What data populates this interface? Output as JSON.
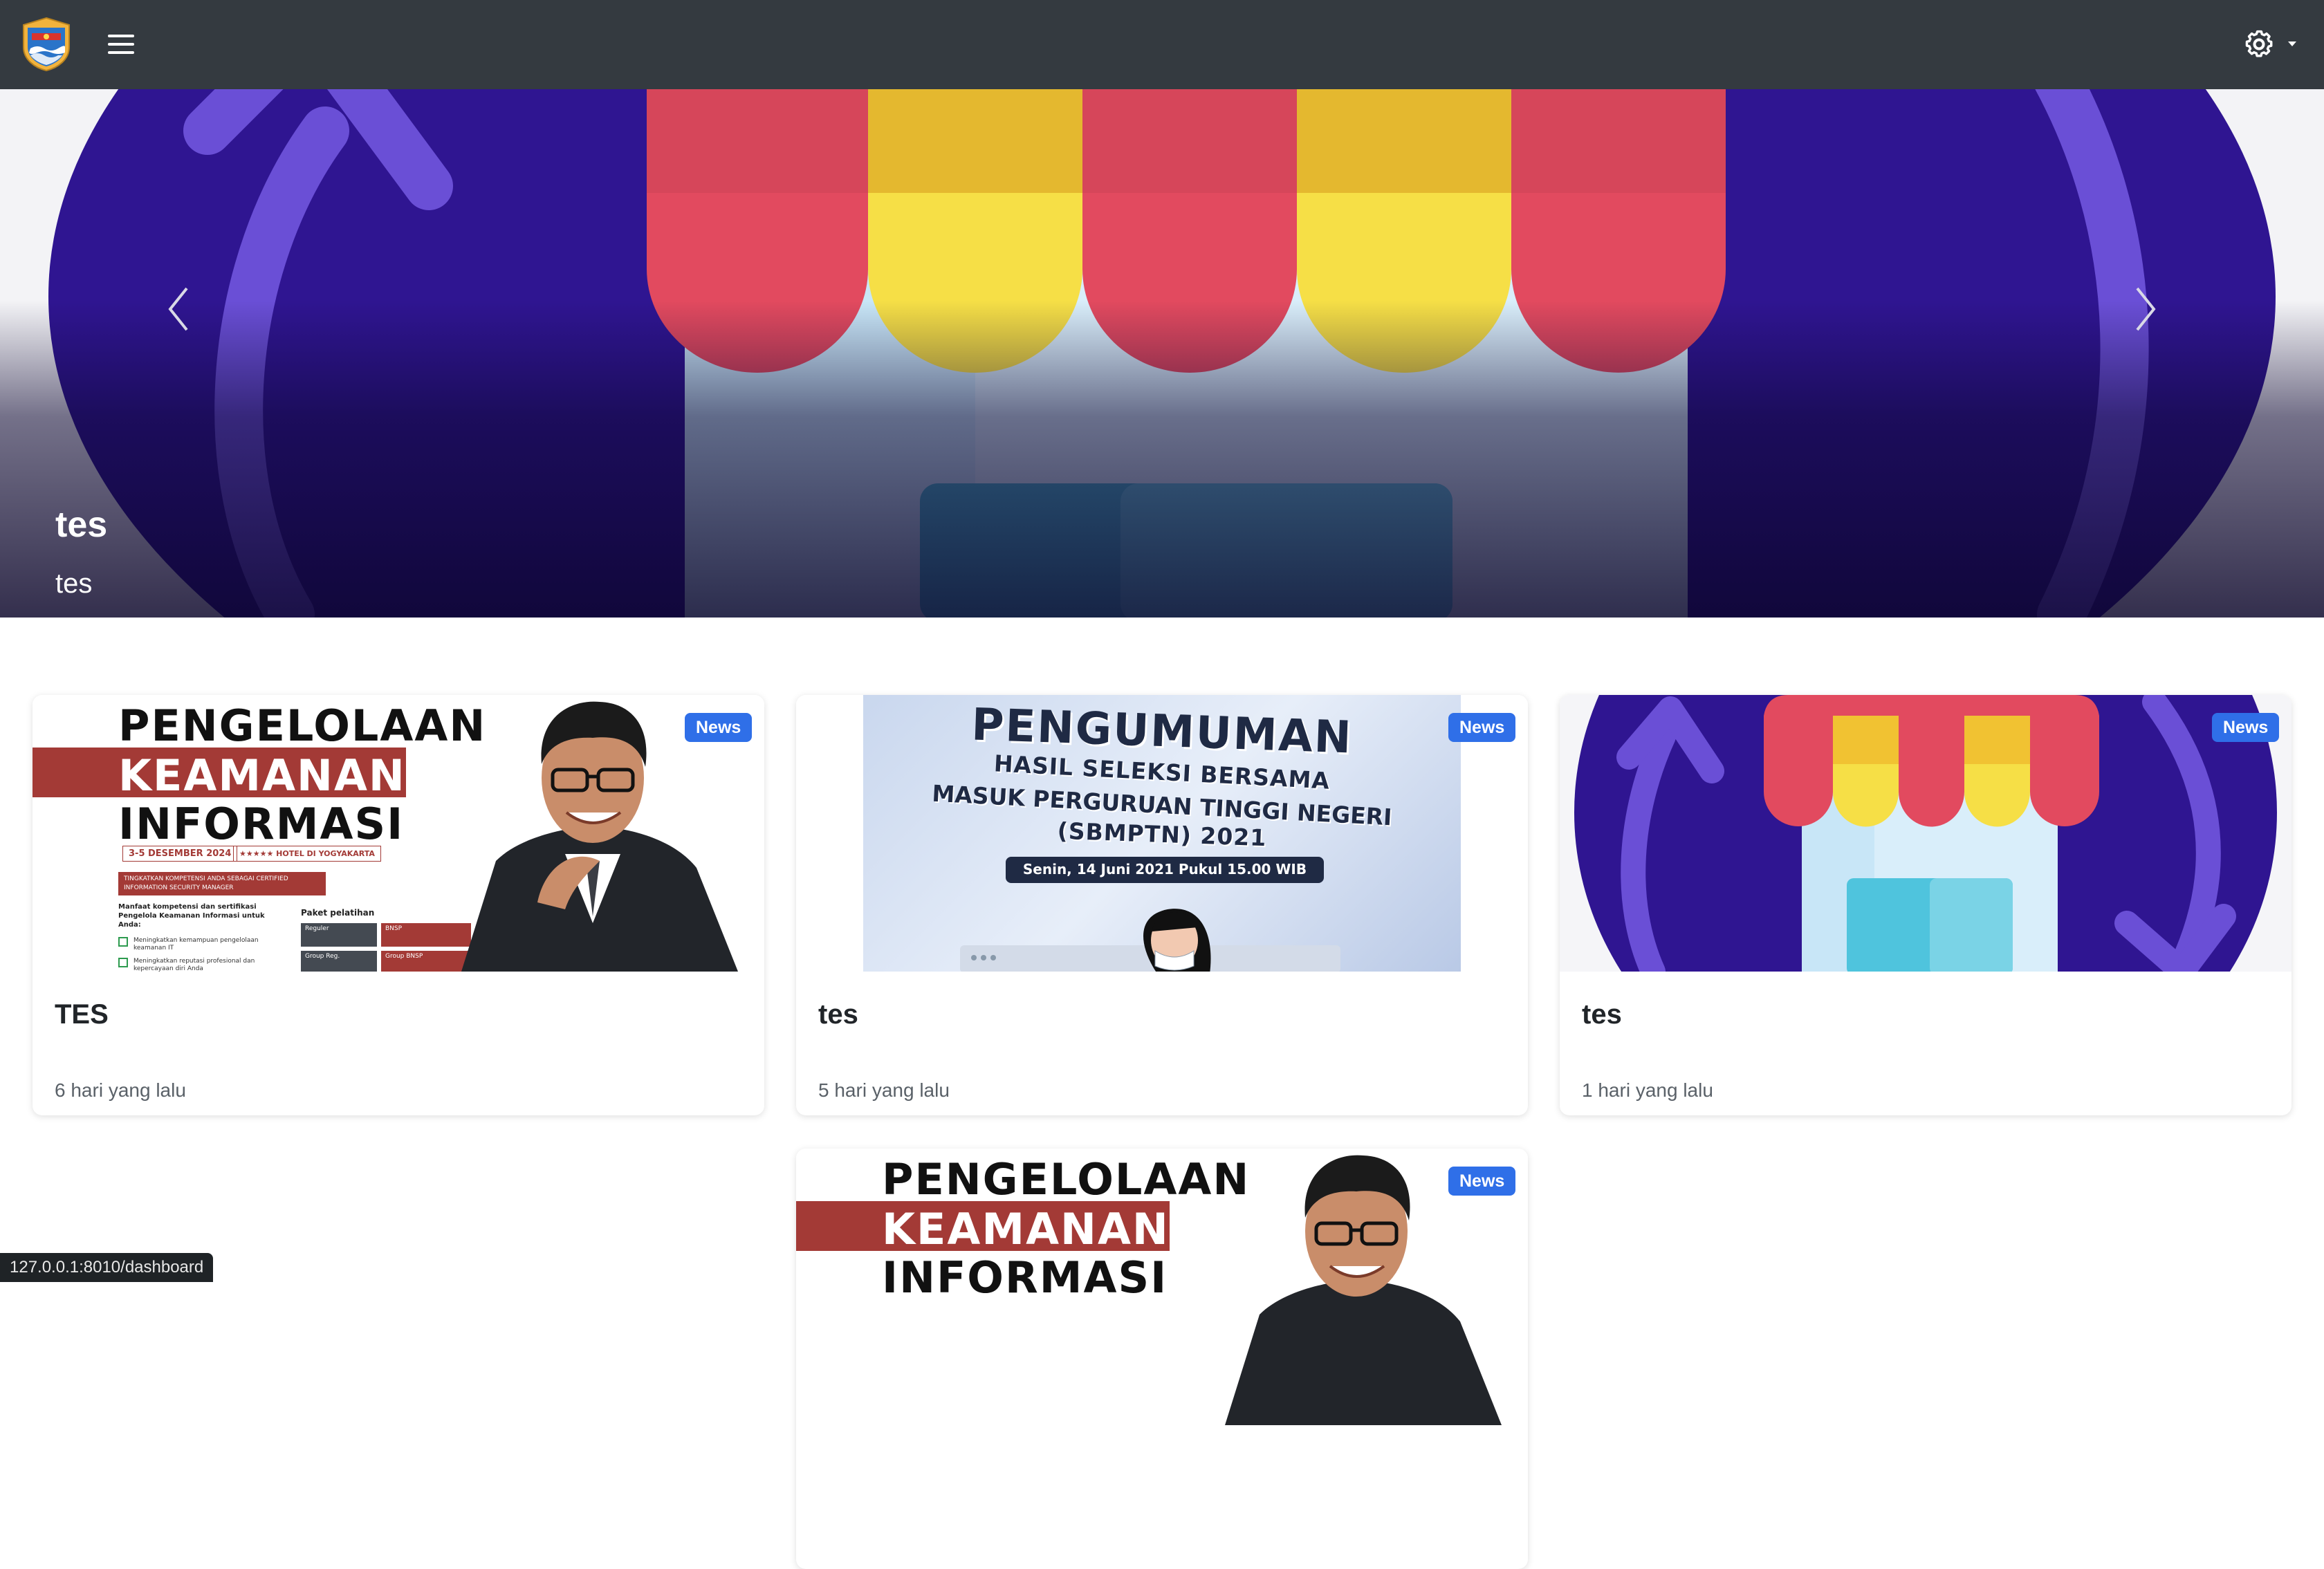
{
  "navbar": {
    "logo_icon": "city-emblem-logo",
    "menu_icon": "hamburger-icon",
    "settings_icon": "gear-icon",
    "settings_caret_icon": "caret-down-icon",
    "background": "#343a40"
  },
  "carousel": {
    "slide_title": "tes",
    "slide_caption": "tes",
    "prev_icon": "chevron-left-icon",
    "next_icon": "chevron-right-icon",
    "slide_count": 3,
    "active_slide": 2
  },
  "cards": [
    {
      "badge": "News",
      "title": "TES",
      "time": "6 hari yang lalu",
      "poster": {
        "line1": "PENGELOLAAN",
        "line2": "KEAMANAN",
        "line3": "INFORMASI",
        "date": "3-5 DESEMBER 2024",
        "venue": "★★★★★ HOTEL DI YOGYAKARTA",
        "banner": "TINGKATKAN KOMPETENSI ANDA SEBAGAI CERTIFIED INFORMATION SECURITY MANAGER",
        "benefit_title": "Manfaat kompetensi dan sertifikasi Pengelola Keamanan Informasi untuk Anda:",
        "benefit_1": "Meningkatkan kemampuan pengelolaan keamanan IT",
        "benefit_2": "Meningkatkan reputasi profesional dan kepercayaan diri Anda",
        "package_title": "Paket pelatihan",
        "package_1": "Reguler",
        "package_2": "BNSP",
        "package_3": "Group Reg.",
        "package_4": "Group BNSP"
      }
    },
    {
      "badge": "News",
      "title": "tes",
      "time": "5 hari yang lalu",
      "poster": {
        "line1": "PENGUMUMAN",
        "line2": "HASIL SELEKSI BERSAMA",
        "line3": "MASUK PERGURUAN TINGGI NEGERI",
        "line4": "(SBMPTN) 2021",
        "date": "Senin, 14 Juni 2021 Pukul 15.00 WIB"
      }
    },
    {
      "badge": "News",
      "title": "tes",
      "time": "1 hari yang lalu",
      "image_icon": "storefront-icon"
    },
    {
      "badge": "News",
      "poster": {
        "line1": "PENGELOLAAN",
        "line2": "KEAMANAN",
        "line3": "INFORMASI"
      }
    }
  ],
  "statusbar": {
    "url": "127.0.0.1:8010/dashboard"
  }
}
